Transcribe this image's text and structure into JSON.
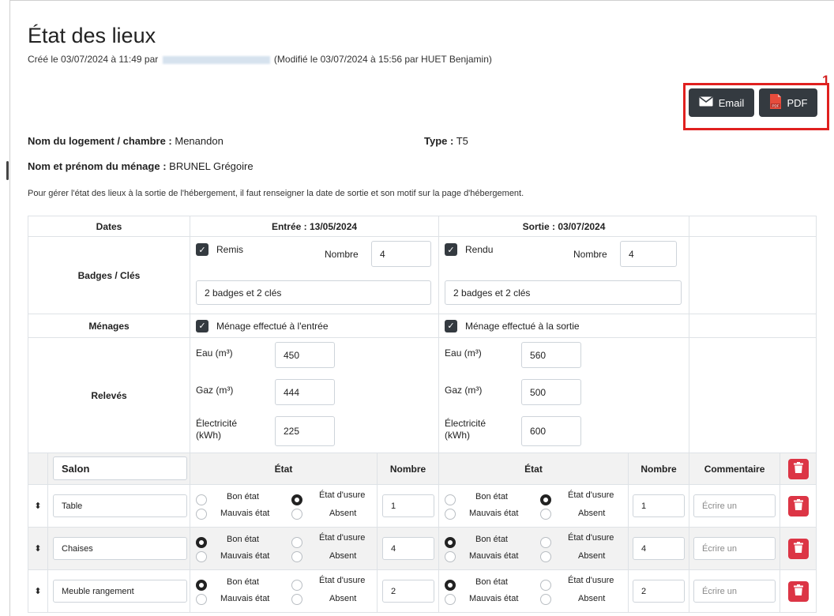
{
  "page": {
    "title": "État des lieux",
    "meta_prefix": "Créé le 03/07/2024 à 11:49 par",
    "meta_suffix": "(Modifié le 03/07/2024 à 15:56 par HUET Benjamin)",
    "annotation_marker": "1",
    "info_text": "Pour gérer l'état des lieux à la sortie de l'hébergement, il faut renseigner la date de sortie et son motif sur la page d'hébergement."
  },
  "toolbar": {
    "email_label": "Email",
    "pdf_label": "PDF"
  },
  "housing": {
    "name_label": "Nom du logement / chambre :",
    "name_value": " Menandon",
    "type_label": "Type :",
    "type_value": " T5",
    "household_label": "Nom et prénom du ménage :",
    "household_value": " BRUNEL Grégoire"
  },
  "table": {
    "header": {
      "dates": "Dates",
      "entry": "Entrée : 13/05/2024",
      "exit": "Sortie : 03/07/2024"
    },
    "badges": {
      "label": "Badges / Clés",
      "entry_check": "Remis",
      "exit_check": "Rendu",
      "count_label": "Nombre",
      "entry_count": "4",
      "exit_count": "4",
      "entry_note": "2 badges et 2 clés",
      "exit_note": "2 badges et 2 clés"
    },
    "menages": {
      "label": "Ménages",
      "entry": "Ménage effectué à l'entrée",
      "exit": "Ménage effectué à la sortie"
    },
    "releves": {
      "label": "Relevés",
      "eau_label": "Eau (m³)",
      "gaz_label": "Gaz (m³)",
      "elec_label_1": "Électricité",
      "elec_label_2": "(kWh)",
      "entry": {
        "eau": "450",
        "gaz": "444",
        "elec": "225"
      },
      "exit": {
        "eau": "560",
        "gaz": "500",
        "elec": "600"
      }
    },
    "room": {
      "name": "Salon",
      "etat_header": "État",
      "nombre_header": "Nombre",
      "commentaire_header": "Commentaire",
      "opt_bon": "Bon état",
      "opt_usure": "État d'usure",
      "opt_mauvais": "Mauvais état",
      "opt_absent": "Absent",
      "comment_placeholder": "Écrire un",
      "items": [
        {
          "name": "Table",
          "entry_count": "1",
          "exit_count": "1"
        },
        {
          "name": "Chaises",
          "entry_count": "4",
          "exit_count": "4"
        },
        {
          "name": "Meuble rangement",
          "entry_count": "2",
          "exit_count": "2"
        }
      ]
    }
  },
  "colors": {
    "dark_button": "#343a40",
    "danger": "#dc3545",
    "highlight": "#e0201f"
  }
}
